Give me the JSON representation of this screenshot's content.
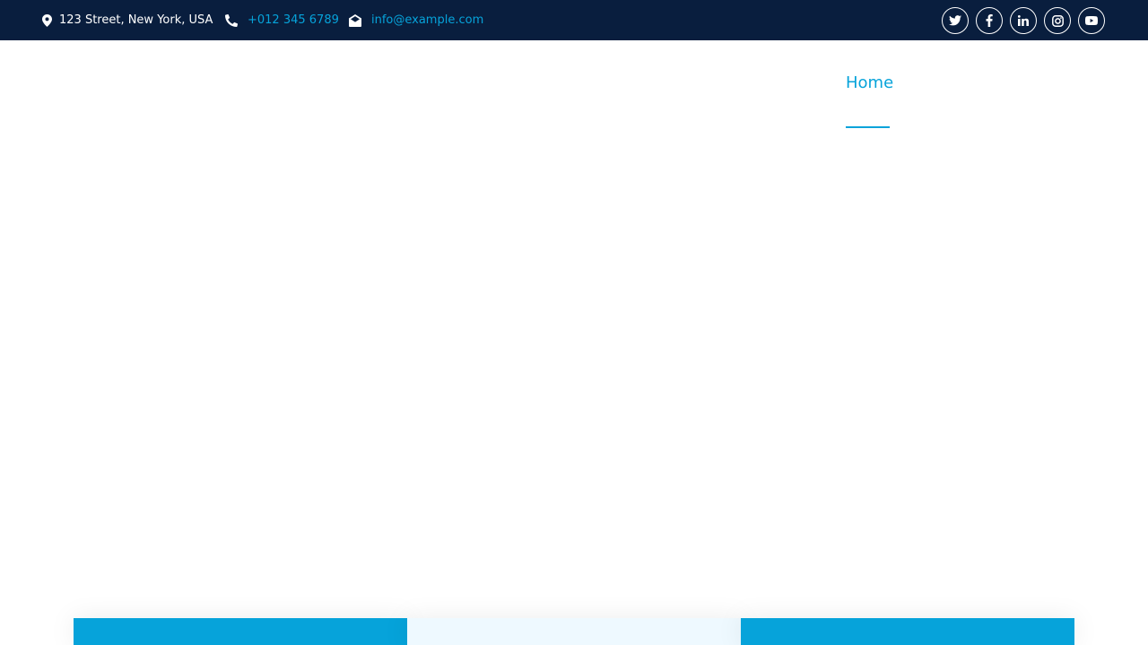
{
  "topbar": {
    "address": {
      "icon": "map-marker-icon",
      "text": "123 Street, New York, USA"
    },
    "phone": {
      "icon": "phone-icon",
      "text": "+012 345 6789"
    },
    "email": {
      "icon": "envelope-open-icon",
      "text": "info@example.com"
    },
    "social": [
      {
        "icon": "twitter-icon"
      },
      {
        "icon": "facebook-icon"
      },
      {
        "icon": "linkedin-icon"
      },
      {
        "icon": "instagram-icon"
      },
      {
        "icon": "youtube-icon"
      }
    ]
  },
  "nav": {
    "items": [
      {
        "label": "Home",
        "active": true
      }
    ]
  },
  "colors": {
    "topbar_bg": "#091e3e",
    "accent": "#06a3da",
    "light_card": "#eef9ff",
    "white": "#ffffff"
  }
}
